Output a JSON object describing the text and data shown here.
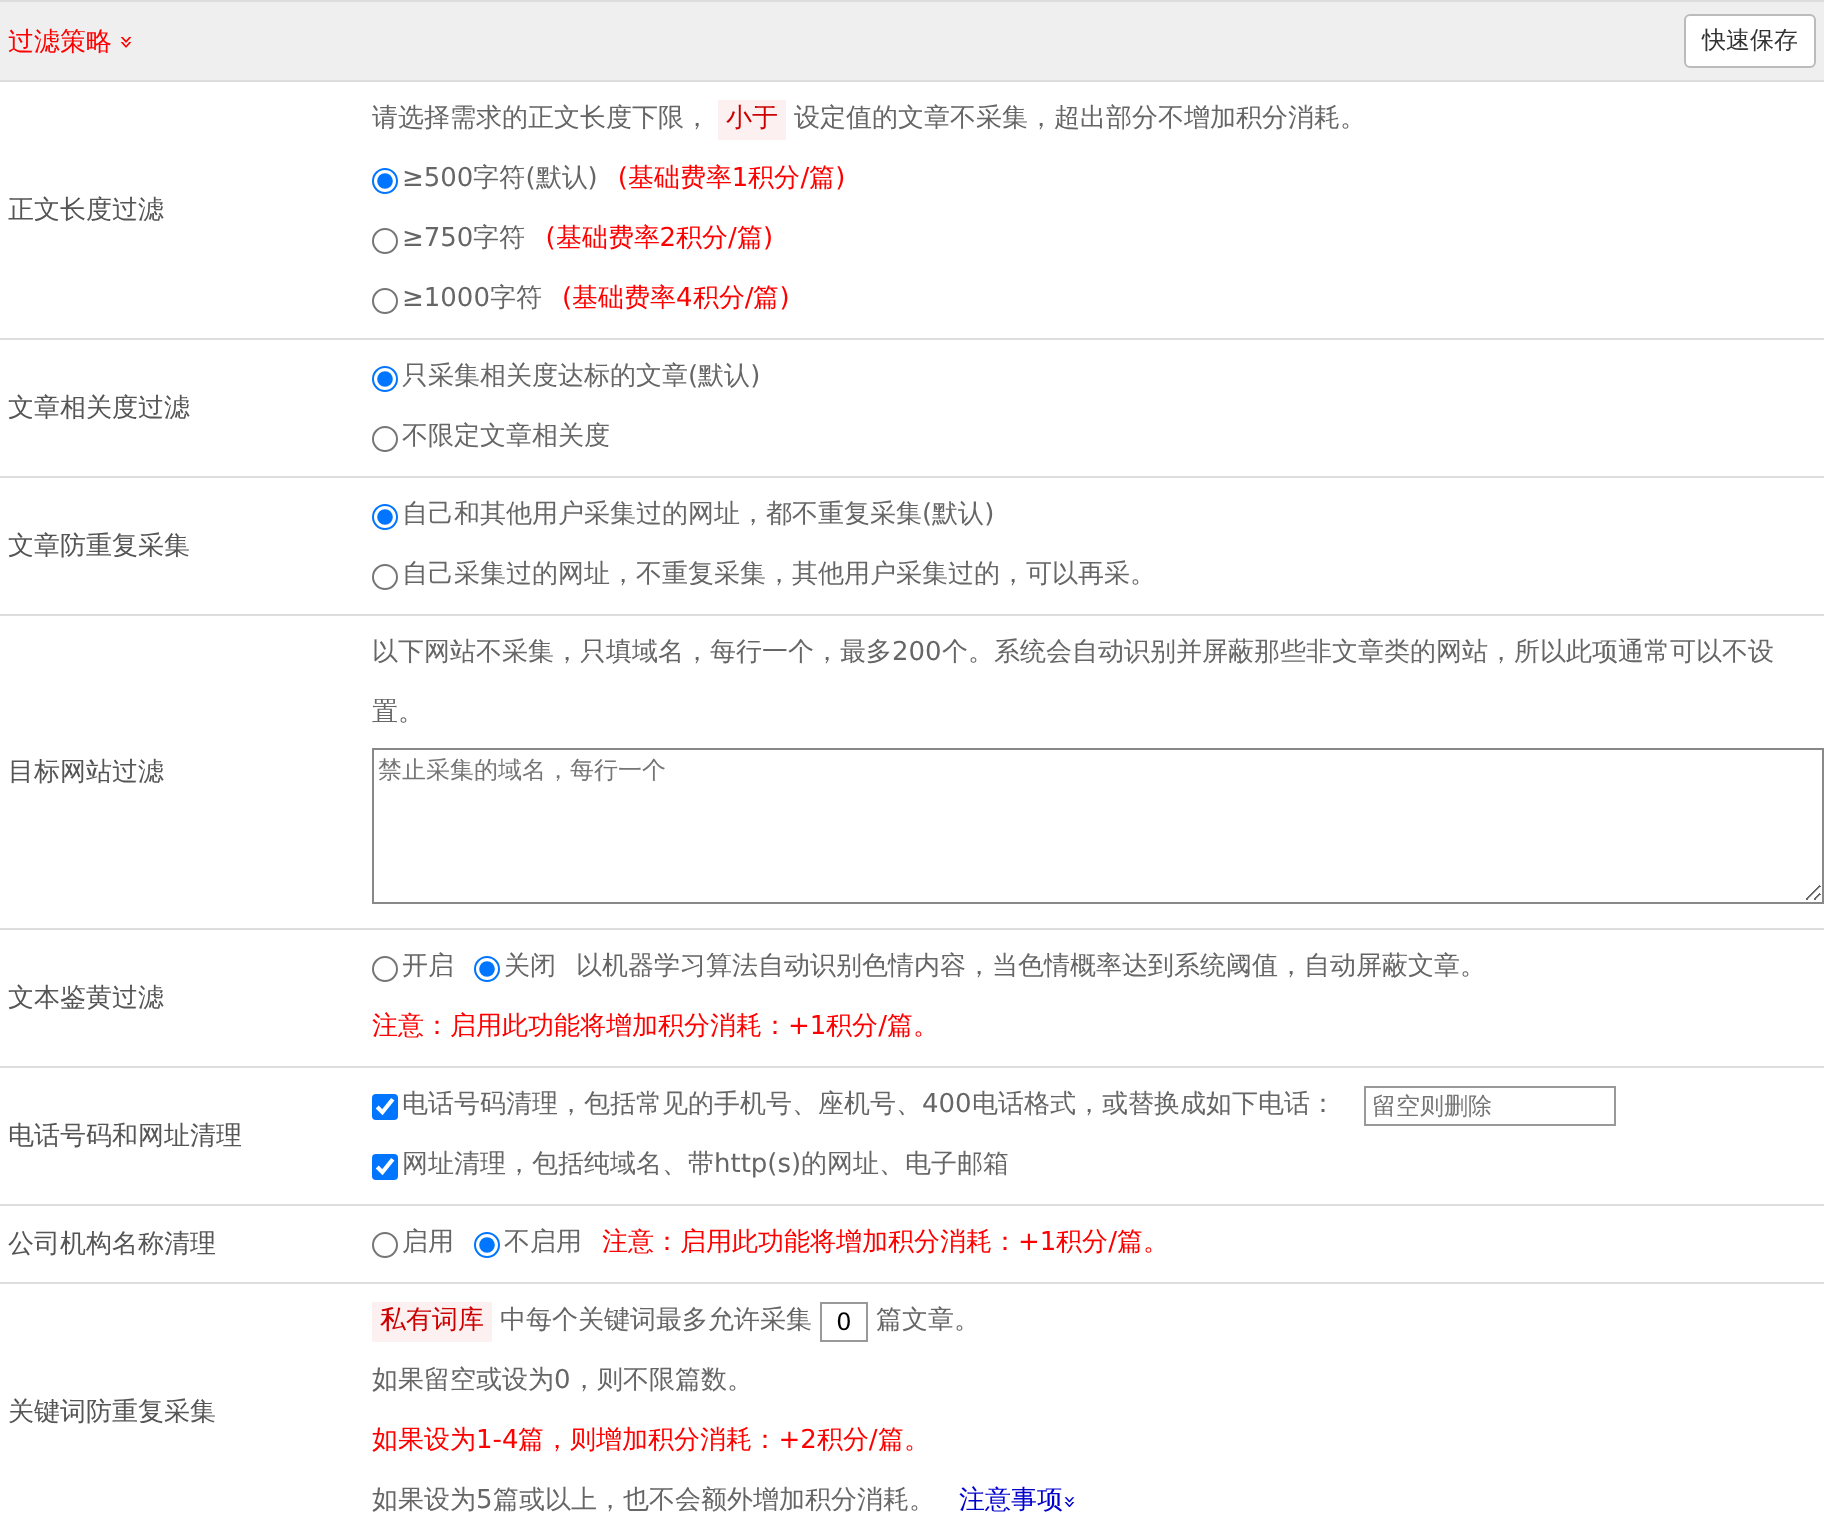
{
  "header": {
    "title": "过滤策略",
    "expand_icon": "»",
    "button": "快速保存"
  },
  "rows": [
    {
      "label": "正文长度过滤",
      "lines": [
        [
          {
            "kind": "text",
            "text": "请选择需求的正文长度下限，"
          },
          {
            "kind": "tag",
            "text": "小于"
          },
          {
            "kind": "text",
            "text": "设定值的文章不采集，超出部分不增加积分消耗。"
          }
        ],
        [
          {
            "kind": "radio",
            "text": "≥500字符(默认)",
            "selected": true
          },
          {
            "kind": "note",
            "text": "(基础费率1积分/篇)"
          }
        ],
        [
          {
            "kind": "radio",
            "text": "≥750字符",
            "selected": false
          },
          {
            "kind": "note",
            "text": "(基础费率2积分/篇)"
          }
        ],
        [
          {
            "kind": "radio",
            "text": "≥1000字符",
            "selected": false
          },
          {
            "kind": "note",
            "text": "(基础费率4积分/篇)"
          }
        ]
      ]
    },
    {
      "label": "文章相关度过滤",
      "lines": [
        [
          {
            "kind": "radio",
            "text": "只采集相关度达标的文章(默认)",
            "selected": true
          }
        ],
        [
          {
            "kind": "radio",
            "text": "不限定文章相关度",
            "selected": false
          }
        ]
      ]
    },
    {
      "label": "文章防重复采集",
      "lines": [
        [
          {
            "kind": "radio",
            "text": "自己和其他用户采集过的网址，都不重复采集(默认)",
            "selected": true
          }
        ],
        [
          {
            "kind": "radio",
            "text": "自己采集过的网址，不重复采集，其他用户采集过的，可以再采。",
            "selected": false
          }
        ]
      ]
    },
    {
      "label": "目标网站过滤",
      "lines": [
        [
          {
            "kind": "text",
            "text": "以下网站不采集，只填域名，每行一个，最多200个。系统会自动识别并屏蔽那些非文章类的网站，所以此项通常可以不设置。"
          }
        ],
        [
          {
            "kind": "textarea",
            "placeholder": "禁止采集的域名，每行一个"
          }
        ]
      ]
    },
    {
      "label": "文本鉴黄过滤",
      "lines": [
        [
          {
            "kind": "radio",
            "text": "开启",
            "selected": false
          },
          {
            "kind": "radio",
            "text": "关闭",
            "selected": true
          },
          {
            "kind": "text",
            "text": "以机器学习算法自动识别色情内容，当色情概率达到系统阈值，自动屏蔽文章。"
          }
        ],
        [
          {
            "kind": "note",
            "text": "注意：启用此功能将增加积分消耗：+1积分/篇。"
          }
        ]
      ]
    },
    {
      "label": "电话号码和网址清理",
      "lines": [
        [
          {
            "kind": "checkbox",
            "text": "电话号码清理，包括常见的手机号、座机号、400电话格式，或替换成如下电话：",
            "checked": true
          },
          {
            "kind": "input",
            "placeholder": "留空则删除"
          }
        ],
        [
          {
            "kind": "checkbox",
            "text": "网址清理，包括纯域名、带http(s)的网址、电子邮箱",
            "checked": true
          }
        ]
      ]
    },
    {
      "label": "公司机构名称清理",
      "lines": [
        [
          {
            "kind": "radio",
            "text": "启用",
            "selected": false
          },
          {
            "kind": "radio",
            "text": "不启用",
            "selected": true
          },
          {
            "kind": "note",
            "text": "注意：启用此功能将增加积分消耗：+1积分/篇。"
          }
        ]
      ]
    },
    {
      "label": "关键词防重复采集",
      "lines": [
        [
          {
            "kind": "tag",
            "text": "私有词库"
          },
          {
            "kind": "text",
            "text": "中每个关键词最多允许采集"
          },
          {
            "kind": "number",
            "value": "0"
          },
          {
            "kind": "text",
            "text": "篇文章。"
          }
        ],
        [
          {
            "kind": "text",
            "text": "如果留空或设为0，则不限篇数。"
          }
        ],
        [
          {
            "kind": "note",
            "text": "如果设为1-4篇，则增加积分消耗：+2积分/篇。"
          }
        ],
        [
          {
            "kind": "text",
            "text": "如果设为5篇或以上，也不会额外增加积分消耗。"
          },
          {
            "kind": "link",
            "text": "注意事项",
            "icon": "»"
          }
        ]
      ]
    }
  ]
}
